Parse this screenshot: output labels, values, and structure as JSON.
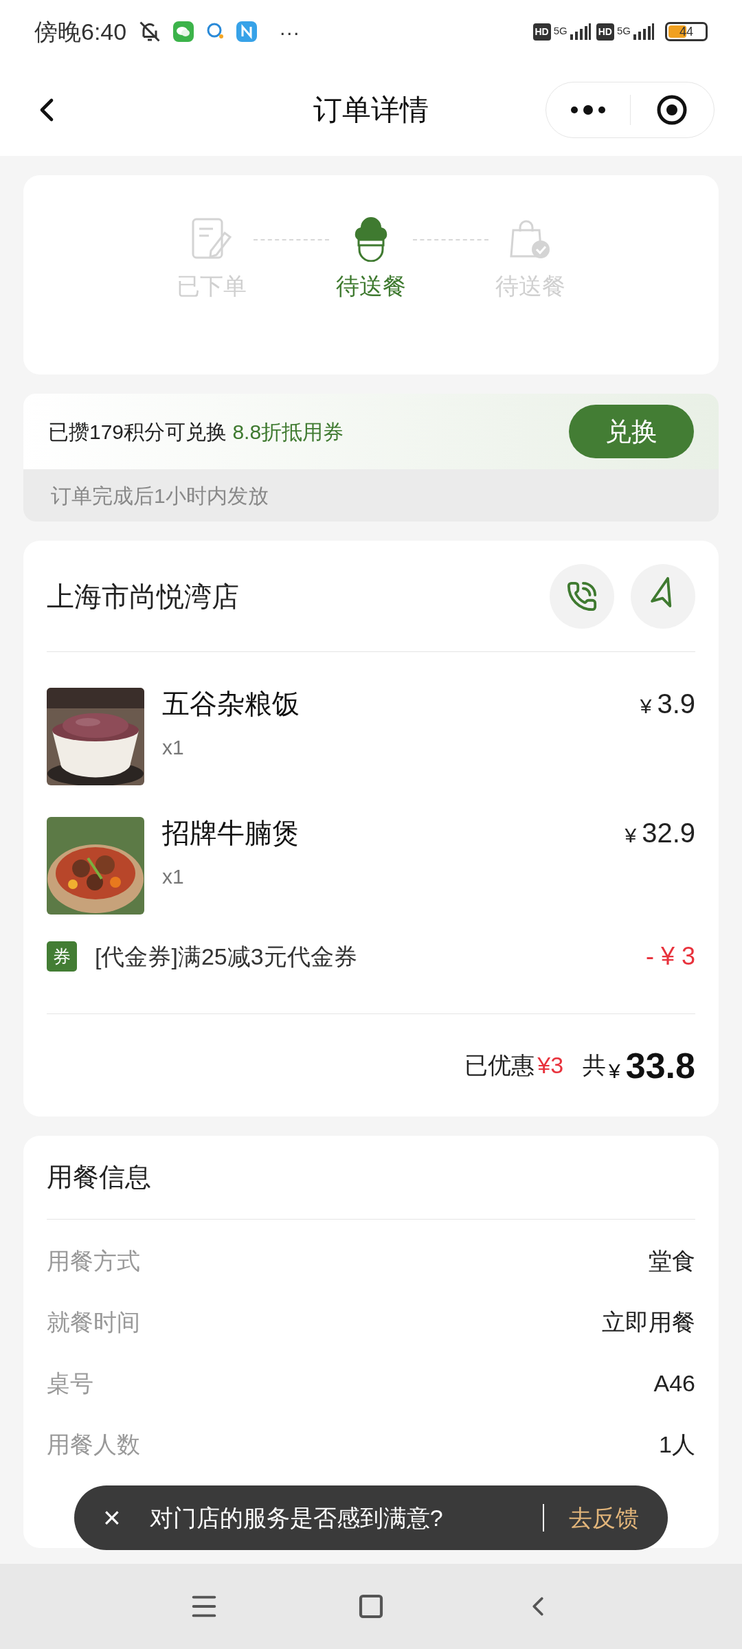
{
  "status_bar": {
    "time": "傍晚6:40",
    "network": [
      {
        "badge": "HD",
        "label": "5G"
      },
      {
        "badge": "HD",
        "label": "5G"
      }
    ],
    "battery": "44",
    "more": "···"
  },
  "nav": {
    "title": "订单详情"
  },
  "steps": [
    {
      "label": "已下单",
      "kind": "order",
      "selected": false
    },
    {
      "label": "待送餐",
      "kind": "chef",
      "selected": true
    },
    {
      "label": "待送餐",
      "kind": "bag",
      "selected": false
    }
  ],
  "points": {
    "text": "已攒179积分可兑换",
    "highlight": "8.8折抵用券",
    "button": "兑换",
    "note": "订单完成后1小时内发放"
  },
  "store": {
    "name": "上海市尚悦湾店",
    "items": [
      {
        "name": "五谷杂粮饭",
        "qty": "x1",
        "price": "3.9",
        "currency": "¥",
        "kind": "rice"
      },
      {
        "name": "招牌牛腩煲",
        "qty": "x1",
        "price": "32.9",
        "currency": "¥",
        "kind": "stew"
      }
    ],
    "coupon": {
      "badge": "券",
      "text": "[代金券]满25减3元代金券",
      "amount": "- ¥ 3"
    },
    "summary": {
      "discount_label": "已优惠",
      "discount": "¥3",
      "total_label": "共",
      "currency": "¥",
      "total": "33.8"
    }
  },
  "dining_info": {
    "title": "用餐信息",
    "rows": [
      {
        "label": "用餐方式",
        "value": "堂食"
      },
      {
        "label": "就餐时间",
        "value": "立即用餐"
      },
      {
        "label": "桌号",
        "value": "A46"
      },
      {
        "label": "用餐人数",
        "value": "1人"
      }
    ]
  },
  "toast": {
    "close": "×",
    "text": "对门店的服务是否感到满意?",
    "action": "去反馈"
  }
}
